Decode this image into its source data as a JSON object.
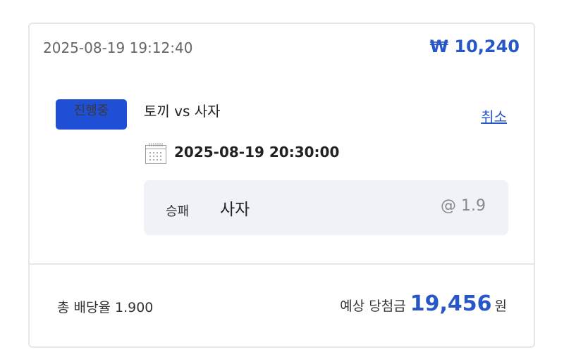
{
  "bet": {
    "placed_at": "2025-08-19 19:12:40",
    "stake": "₩ 10,240",
    "status_badge": "진행중",
    "match": "토끼 vs 사자",
    "cancel_label": "취소",
    "event_time": "2025-08-19 20:30:00",
    "pick": {
      "market": "승패",
      "selection": "사자",
      "odds": "@ 1.9"
    }
  },
  "summary": {
    "total_odds": "총 배당율 1.900",
    "expected_label": "예상 당첨금",
    "expected_amount": "19,456",
    "currency_unit": "원"
  },
  "colors": {
    "accent": "#2756c8",
    "badge_bg": "#1e4fd4",
    "pick_bg": "#eff2f7",
    "border": "#e4e7ec"
  },
  "icons": {
    "event_time": "calendar-icon"
  }
}
